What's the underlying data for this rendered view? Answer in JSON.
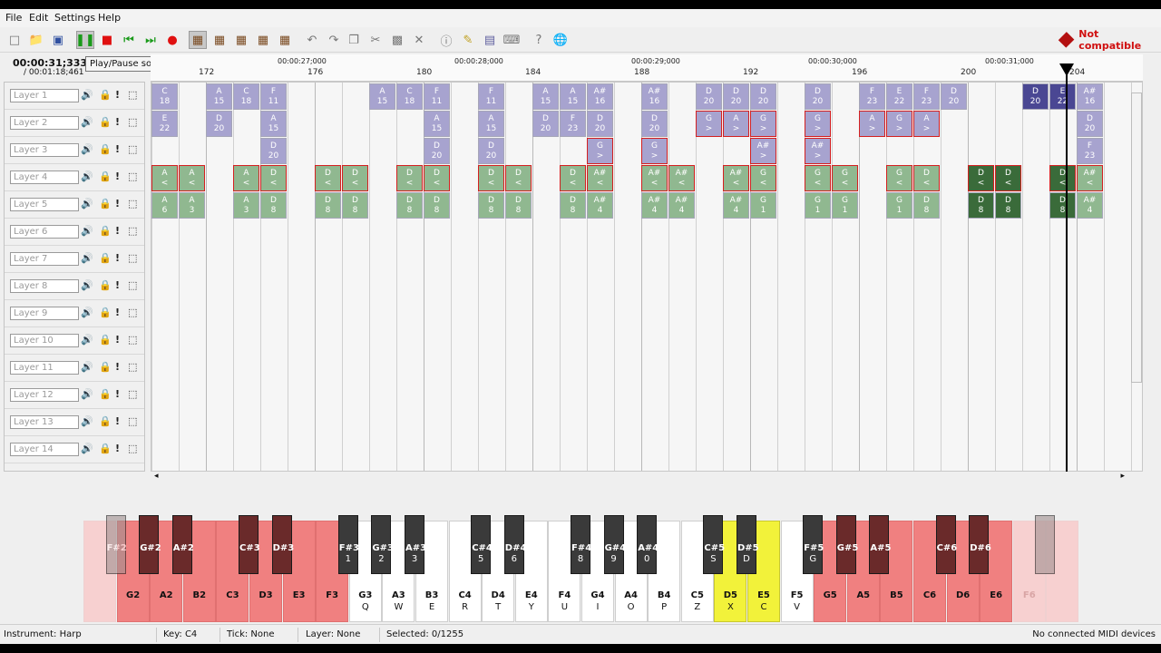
{
  "menu": {
    "file": "File",
    "edit": "Edit",
    "settings": "Settings",
    "help": "Help"
  },
  "toolbar": {
    "not_compatible": "Not compatible",
    "icons": [
      "new-file-icon",
      "open-folder-icon",
      "save-icon",
      "pause-icon",
      "stop-icon",
      "rewind-icon",
      "fast-forward-icon",
      "record-icon",
      "tool-select-icon",
      "tool-add-icon",
      "tool-remove-icon",
      "tool-edit-icon",
      "tool-move-icon",
      "undo-icon",
      "redo-icon",
      "copy-icon",
      "cut-icon",
      "paste-icon",
      "delete-icon",
      "info-icon",
      "edit-icon",
      "instruments-icon",
      "midi-icon",
      "help-icon",
      "globe-icon"
    ],
    "colors": {
      "record": "#e01010",
      "stop": "#e01010",
      "play": "#1a9a1a",
      "warning": "#d01010"
    }
  },
  "time": {
    "current": "00:00:31;333",
    "total": "/ 00:01:18;461"
  },
  "tooltip": "Play/Pause song",
  "ruler": {
    "ticks": [
      "172",
      "176",
      "180",
      "184",
      "188",
      "192",
      "196",
      "200",
      "204"
    ],
    "times": [
      "00:00:27;000",
      "00:00:28;000",
      "00:00:29;000",
      "00:00:30;000",
      "00:00:31;000"
    ]
  },
  "layers": [
    "Layer 1",
    "Layer 2",
    "Layer 3",
    "Layer 4",
    "Layer 5",
    "Layer 6",
    "Layer 7",
    "Layer 8",
    "Layer 9",
    "Layer 10",
    "Layer 11",
    "Layer 12",
    "Layer 13",
    "Layer 14"
  ],
  "notes": [
    {
      "layer": 0,
      "col": 0,
      "key": "C",
      "val": "18",
      "c": "blue"
    },
    {
      "layer": 0,
      "col": 2,
      "key": "A",
      "val": "15",
      "c": "blue"
    },
    {
      "layer": 0,
      "col": 3,
      "key": "C",
      "val": "18",
      "c": "blue"
    },
    {
      "layer": 0,
      "col": 4,
      "key": "F",
      "val": "11",
      "c": "blue"
    },
    {
      "layer": 0,
      "col": 8,
      "key": "A",
      "val": "15",
      "c": "blue"
    },
    {
      "layer": 0,
      "col": 9,
      "key": "C",
      "val": "18",
      "c": "blue"
    },
    {
      "layer": 0,
      "col": 10,
      "key": "F",
      "val": "11",
      "c": "blue"
    },
    {
      "layer": 0,
      "col": 12,
      "key": "F",
      "val": "11",
      "c": "blue"
    },
    {
      "layer": 0,
      "col": 14,
      "key": "A",
      "val": "15",
      "c": "blue"
    },
    {
      "layer": 0,
      "col": 15,
      "key": "A",
      "val": "15",
      "c": "blue"
    },
    {
      "layer": 0,
      "col": 16,
      "key": "A#",
      "val": "16",
      "c": "blue"
    },
    {
      "layer": 0,
      "col": 18,
      "key": "A#",
      "val": "16",
      "c": "blue"
    },
    {
      "layer": 0,
      "col": 20,
      "key": "D",
      "val": "20",
      "c": "blue"
    },
    {
      "layer": 0,
      "col": 21,
      "key": "D",
      "val": "20",
      "c": "blue"
    },
    {
      "layer": 0,
      "col": 22,
      "key": "D",
      "val": "20",
      "c": "blue"
    },
    {
      "layer": 0,
      "col": 24,
      "key": "D",
      "val": "20",
      "c": "blue"
    },
    {
      "layer": 0,
      "col": 26,
      "key": "F",
      "val": "23",
      "c": "blue"
    },
    {
      "layer": 0,
      "col": 27,
      "key": "E",
      "val": "22",
      "c": "blue"
    },
    {
      "layer": 0,
      "col": 28,
      "key": "F",
      "val": "23",
      "c": "blue"
    },
    {
      "layer": 0,
      "col": 29,
      "key": "D",
      "val": "20",
      "c": "blue"
    },
    {
      "layer": 0,
      "col": 32,
      "key": "D",
      "val": "20",
      "c": "blue dk"
    },
    {
      "layer": 0,
      "col": 33,
      "key": "E",
      "val": "22",
      "c": "blue dk"
    },
    {
      "layer": 0,
      "col": 34,
      "key": "A#",
      "val": "16",
      "c": "blue"
    },
    {
      "layer": 1,
      "col": 0,
      "key": "E",
      "val": "22",
      "c": "blue"
    },
    {
      "layer": 1,
      "col": 2,
      "key": "D",
      "val": "20",
      "c": "blue"
    },
    {
      "layer": 1,
      "col": 4,
      "key": "A",
      "val": "15",
      "c": "blue"
    },
    {
      "layer": 1,
      "col": 10,
      "key": "A",
      "val": "15",
      "c": "blue"
    },
    {
      "layer": 1,
      "col": 12,
      "key": "A",
      "val": "15",
      "c": "blue"
    },
    {
      "layer": 1,
      "col": 14,
      "key": "D",
      "val": "20",
      "c": "blue"
    },
    {
      "layer": 1,
      "col": 15,
      "key": "F",
      "val": "23",
      "c": "blue"
    },
    {
      "layer": 1,
      "col": 16,
      "key": "D",
      "val": "20",
      "c": "blue"
    },
    {
      "layer": 1,
      "col": 18,
      "key": "D",
      "val": "20",
      "c": "blue"
    },
    {
      "layer": 1,
      "col": 20,
      "key": "G",
      "val": ">",
      "c": "blue red"
    },
    {
      "layer": 1,
      "col": 21,
      "key": "A",
      "val": ">",
      "c": "blue red"
    },
    {
      "layer": 1,
      "col": 22,
      "key": "G",
      "val": ">",
      "c": "blue red"
    },
    {
      "layer": 1,
      "col": 24,
      "key": "G",
      "val": ">",
      "c": "blue red"
    },
    {
      "layer": 1,
      "col": 26,
      "key": "A",
      "val": ">",
      "c": "blue red"
    },
    {
      "layer": 1,
      "col": 27,
      "key": "G",
      "val": ">",
      "c": "blue red"
    },
    {
      "layer": 1,
      "col": 28,
      "key": "A",
      "val": ">",
      "c": "blue red"
    },
    {
      "layer": 1,
      "col": 34,
      "key": "D",
      "val": "20",
      "c": "blue"
    },
    {
      "layer": 2,
      "col": 4,
      "key": "D",
      "val": "20",
      "c": "blue"
    },
    {
      "layer": 2,
      "col": 10,
      "key": "D",
      "val": "20",
      "c": "blue"
    },
    {
      "layer": 2,
      "col": 12,
      "key": "D",
      "val": "20",
      "c": "blue"
    },
    {
      "layer": 2,
      "col": 16,
      "key": "G",
      "val": ">",
      "c": "blue red"
    },
    {
      "layer": 2,
      "col": 18,
      "key": "G",
      "val": ">",
      "c": "blue red"
    },
    {
      "layer": 2,
      "col": 22,
      "key": "A#",
      "val": ">",
      "c": "blue red"
    },
    {
      "layer": 2,
      "col": 24,
      "key": "A#",
      "val": ">",
      "c": "blue red"
    },
    {
      "layer": 2,
      "col": 34,
      "key": "F",
      "val": "23",
      "c": "blue"
    },
    {
      "layer": 3,
      "col": 0,
      "key": "A",
      "val": "<",
      "c": "green red"
    },
    {
      "layer": 3,
      "col": 1,
      "key": "A",
      "val": "<",
      "c": "green red"
    },
    {
      "layer": 3,
      "col": 3,
      "key": "A",
      "val": "<",
      "c": "green red"
    },
    {
      "layer": 3,
      "col": 4,
      "key": "D",
      "val": "<",
      "c": "green red"
    },
    {
      "layer": 3,
      "col": 6,
      "key": "D",
      "val": "<",
      "c": "green red"
    },
    {
      "layer": 3,
      "col": 7,
      "key": "D",
      "val": "<",
      "c": "green red"
    },
    {
      "layer": 3,
      "col": 9,
      "key": "D",
      "val": "<",
      "c": "green red"
    },
    {
      "layer": 3,
      "col": 10,
      "key": "D",
      "val": "<",
      "c": "green red"
    },
    {
      "layer": 3,
      "col": 12,
      "key": "D",
      "val": "<",
      "c": "green red"
    },
    {
      "layer": 3,
      "col": 13,
      "key": "D",
      "val": "<",
      "c": "green red"
    },
    {
      "layer": 3,
      "col": 15,
      "key": "D",
      "val": "<",
      "c": "green red"
    },
    {
      "layer": 3,
      "col": 16,
      "key": "A#",
      "val": "<",
      "c": "green red"
    },
    {
      "layer": 3,
      "col": 18,
      "key": "A#",
      "val": "<",
      "c": "green red"
    },
    {
      "layer": 3,
      "col": 19,
      "key": "A#",
      "val": "<",
      "c": "green red"
    },
    {
      "layer": 3,
      "col": 21,
      "key": "A#",
      "val": "<",
      "c": "green red"
    },
    {
      "layer": 3,
      "col": 22,
      "key": "G",
      "val": "<",
      "c": "green red"
    },
    {
      "layer": 3,
      "col": 24,
      "key": "G",
      "val": "<",
      "c": "green red"
    },
    {
      "layer": 3,
      "col": 25,
      "key": "G",
      "val": "<",
      "c": "green red"
    },
    {
      "layer": 3,
      "col": 27,
      "key": "G",
      "val": "<",
      "c": "green red"
    },
    {
      "layer": 3,
      "col": 28,
      "key": "D",
      "val": "<",
      "c": "green red"
    },
    {
      "layer": 3,
      "col": 30,
      "key": "D",
      "val": "<",
      "c": "green dk red"
    },
    {
      "layer": 3,
      "col": 31,
      "key": "D",
      "val": "<",
      "c": "green dk red"
    },
    {
      "layer": 3,
      "col": 33,
      "key": "D",
      "val": "<",
      "c": "green dk red"
    },
    {
      "layer": 3,
      "col": 34,
      "key": "A#",
      "val": "<",
      "c": "green red"
    },
    {
      "layer": 4,
      "col": 0,
      "key": "A",
      "val": "6",
      "c": "green"
    },
    {
      "layer": 4,
      "col": 1,
      "key": "A",
      "val": "3",
      "c": "green"
    },
    {
      "layer": 4,
      "col": 3,
      "key": "A",
      "val": "3",
      "c": "green"
    },
    {
      "layer": 4,
      "col": 4,
      "key": "D",
      "val": "8",
      "c": "green"
    },
    {
      "layer": 4,
      "col": 6,
      "key": "D",
      "val": "8",
      "c": "green"
    },
    {
      "layer": 4,
      "col": 7,
      "key": "D",
      "val": "8",
      "c": "green"
    },
    {
      "layer": 4,
      "col": 9,
      "key": "D",
      "val": "8",
      "c": "green"
    },
    {
      "layer": 4,
      "col": 10,
      "key": "D",
      "val": "8",
      "c": "green"
    },
    {
      "layer": 4,
      "col": 12,
      "key": "D",
      "val": "8",
      "c": "green"
    },
    {
      "layer": 4,
      "col": 13,
      "key": "D",
      "val": "8",
      "c": "green"
    },
    {
      "layer": 4,
      "col": 15,
      "key": "D",
      "val": "8",
      "c": "green"
    },
    {
      "layer": 4,
      "col": 16,
      "key": "A#",
      "val": "4",
      "c": "green"
    },
    {
      "layer": 4,
      "col": 18,
      "key": "A#",
      "val": "4",
      "c": "green"
    },
    {
      "layer": 4,
      "col": 19,
      "key": "A#",
      "val": "4",
      "c": "green"
    },
    {
      "layer": 4,
      "col": 21,
      "key": "A#",
      "val": "4",
      "c": "green"
    },
    {
      "layer": 4,
      "col": 22,
      "key": "G",
      "val": "1",
      "c": "green"
    },
    {
      "layer": 4,
      "col": 24,
      "key": "G",
      "val": "1",
      "c": "green"
    },
    {
      "layer": 4,
      "col": 25,
      "key": "G",
      "val": "1",
      "c": "green"
    },
    {
      "layer": 4,
      "col": 27,
      "key": "G",
      "val": "1",
      "c": "green"
    },
    {
      "layer": 4,
      "col": 28,
      "key": "D",
      "val": "8",
      "c": "green"
    },
    {
      "layer": 4,
      "col": 30,
      "key": "D",
      "val": "8",
      "c": "green dk"
    },
    {
      "layer": 4,
      "col": 31,
      "key": "D",
      "val": "8",
      "c": "green dk"
    },
    {
      "layer": 4,
      "col": 33,
      "key": "D",
      "val": "8",
      "c": "green dk"
    },
    {
      "layer": 4,
      "col": 34,
      "key": "A#",
      "val": "4",
      "c": "green"
    }
  ],
  "piano": {
    "white": [
      {
        "n": "",
        "k": "",
        "c": "faded"
      },
      {
        "n": "G2",
        "k": "",
        "c": "red"
      },
      {
        "n": "A2",
        "k": "",
        "c": "red"
      },
      {
        "n": "B2",
        "k": "",
        "c": "red"
      },
      {
        "n": "C3",
        "k": "",
        "c": "red"
      },
      {
        "n": "D3",
        "k": "",
        "c": "red"
      },
      {
        "n": "E3",
        "k": "",
        "c": "red"
      },
      {
        "n": "F3",
        "k": "",
        "c": "red"
      },
      {
        "n": "G3",
        "k": "Q",
        "c": ""
      },
      {
        "n": "A3",
        "k": "W",
        "c": ""
      },
      {
        "n": "B3",
        "k": "E",
        "c": ""
      },
      {
        "n": "C4",
        "k": "R",
        "c": ""
      },
      {
        "n": "D4",
        "k": "T",
        "c": ""
      },
      {
        "n": "E4",
        "k": "Y",
        "c": ""
      },
      {
        "n": "F4",
        "k": "U",
        "c": ""
      },
      {
        "n": "G4",
        "k": "I",
        "c": ""
      },
      {
        "n": "A4",
        "k": "O",
        "c": ""
      },
      {
        "n": "B4",
        "k": "P",
        "c": ""
      },
      {
        "n": "C5",
        "k": "Z",
        "c": ""
      },
      {
        "n": "D5",
        "k": "X",
        "c": "yellow"
      },
      {
        "n": "E5",
        "k": "C",
        "c": "yellow"
      },
      {
        "n": "F5",
        "k": "V",
        "c": ""
      },
      {
        "n": "G5",
        "k": "",
        "c": "red"
      },
      {
        "n": "A5",
        "k": "",
        "c": "red"
      },
      {
        "n": "B5",
        "k": "",
        "c": "red"
      },
      {
        "n": "C6",
        "k": "",
        "c": "red"
      },
      {
        "n": "D6",
        "k": "",
        "c": "red"
      },
      {
        "n": "E6",
        "k": "",
        "c": "red"
      },
      {
        "n": "F6",
        "k": "",
        "c": "faded"
      },
      {
        "n": "",
        "k": "",
        "c": "faded"
      }
    ],
    "black": [
      {
        "after": 0,
        "n": "F#2",
        "k": "",
        "c": "faded"
      },
      {
        "after": 1,
        "n": "G#2",
        "k": "",
        "c": "red"
      },
      {
        "after": 2,
        "n": "A#2",
        "k": "",
        "c": "red"
      },
      {
        "after": 4,
        "n": "C#3",
        "k": "",
        "c": "red"
      },
      {
        "after": 5,
        "n": "D#3",
        "k": "",
        "c": "red"
      },
      {
        "after": 7,
        "n": "F#3",
        "k": "1",
        "c": ""
      },
      {
        "after": 8,
        "n": "G#3",
        "k": "2",
        "c": ""
      },
      {
        "after": 9,
        "n": "A#3",
        "k": "3",
        "c": ""
      },
      {
        "after": 11,
        "n": "C#4",
        "k": "5",
        "c": ""
      },
      {
        "after": 12,
        "n": "D#4",
        "k": "6",
        "c": ""
      },
      {
        "after": 14,
        "n": "F#4",
        "k": "8",
        "c": ""
      },
      {
        "after": 15,
        "n": "G#4",
        "k": "9",
        "c": ""
      },
      {
        "after": 16,
        "n": "A#4",
        "k": "0",
        "c": ""
      },
      {
        "after": 18,
        "n": "C#5",
        "k": "S",
        "c": ""
      },
      {
        "after": 19,
        "n": "D#5",
        "k": "D",
        "c": ""
      },
      {
        "after": 21,
        "n": "F#5",
        "k": "G",
        "c": ""
      },
      {
        "after": 22,
        "n": "G#5",
        "k": "",
        "c": "red"
      },
      {
        "after": 23,
        "n": "A#5",
        "k": "",
        "c": "red"
      },
      {
        "after": 25,
        "n": "C#6",
        "k": "",
        "c": "red"
      },
      {
        "after": 26,
        "n": "D#6",
        "k": "",
        "c": "red"
      },
      {
        "after": 28,
        "n": "",
        "k": "",
        "c": "faded"
      }
    ]
  },
  "status": {
    "instrument": "Instrument: Harp",
    "key": "Key: C4",
    "tick": "Tick: None",
    "layer": "Layer: None",
    "selected": "Selected: 0/1255",
    "midi": "No connected MIDI devices"
  }
}
